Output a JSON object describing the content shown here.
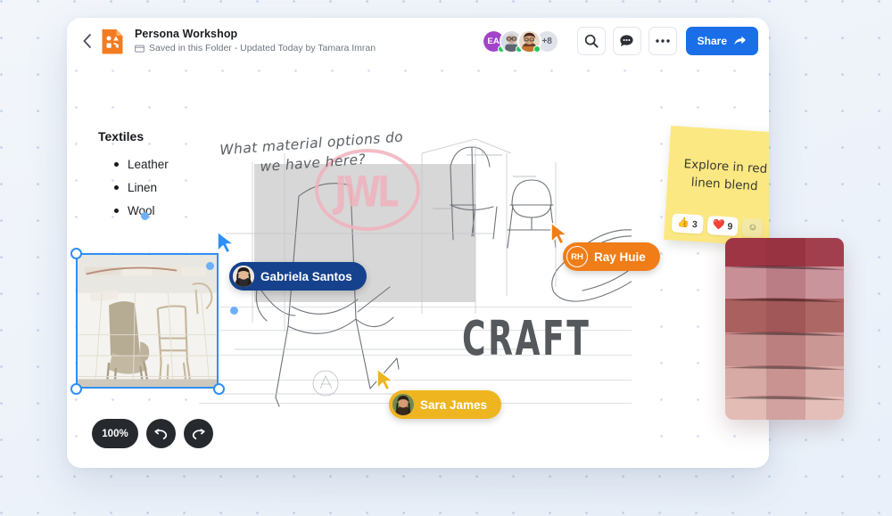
{
  "header": {
    "back_icon": "chevron-left-icon",
    "app_icon": "shapes-document-icon",
    "title": "Persona Workshop",
    "folder_icon": "folder-icon",
    "subtitle": "Saved in this Folder  -  Updated Today by Tamara Imran",
    "avatars": [
      {
        "initials": "EA",
        "color": "#a243c9",
        "type": "initials",
        "online": true
      },
      {
        "initials": "",
        "color": "#c9b39b",
        "type": "photo-man",
        "online": true
      },
      {
        "initials": "",
        "color": "#d8a98d",
        "type": "photo-woman",
        "online": true
      }
    ],
    "avatar_overflow": "+8",
    "buttons": {
      "search_icon": "search-icon",
      "comment_icon": "comment-icon",
      "more_icon": "ellipsis-icon",
      "share_label": "Share",
      "share_icon": "share-arrow-icon",
      "share_color": "#1a6fe8"
    }
  },
  "sidebar": {
    "title": "Textiles",
    "items": [
      "Leather",
      "Linen",
      "Wool"
    ]
  },
  "board": {
    "question": "What material options do we have here?",
    "craft_word": "CRAFT",
    "watermark": "JWL"
  },
  "selected_image": {
    "name": "chair-renders-image",
    "selected": true
  },
  "sticky": {
    "text": "Explore in red linen blend",
    "color": "#fce882",
    "reactions": [
      {
        "icon": "thumbs-up-emoji",
        "glyph": "👍",
        "count": "3"
      },
      {
        "icon": "heart-emoji",
        "glyph": "❤️",
        "count": "9"
      },
      {
        "icon": "add-reaction-emoji",
        "glyph": "☺",
        "count": ""
      }
    ]
  },
  "swatch": {
    "name": "red-fabric-swatch",
    "bands": [
      "#9e3545",
      "#c98b94",
      "#a95f5d",
      "#c89290",
      "#d8aaa5",
      "#e3bcb6"
    ]
  },
  "cursors": [
    {
      "name": "Gabriela Santos",
      "color": "#16418c",
      "avatar_type": "photo-woman",
      "initials": ""
    },
    {
      "name": "Ray Huie",
      "color": "#f07d18",
      "avatar_type": "initials",
      "initials": "RH"
    },
    {
      "name": "Sara James",
      "color": "#efb520",
      "avatar_type": "photo-woman2",
      "initials": ""
    }
  ],
  "zoom_toolbar": {
    "level": "100%",
    "undo_icon": "undo-icon",
    "redo_icon": "redo-icon"
  }
}
